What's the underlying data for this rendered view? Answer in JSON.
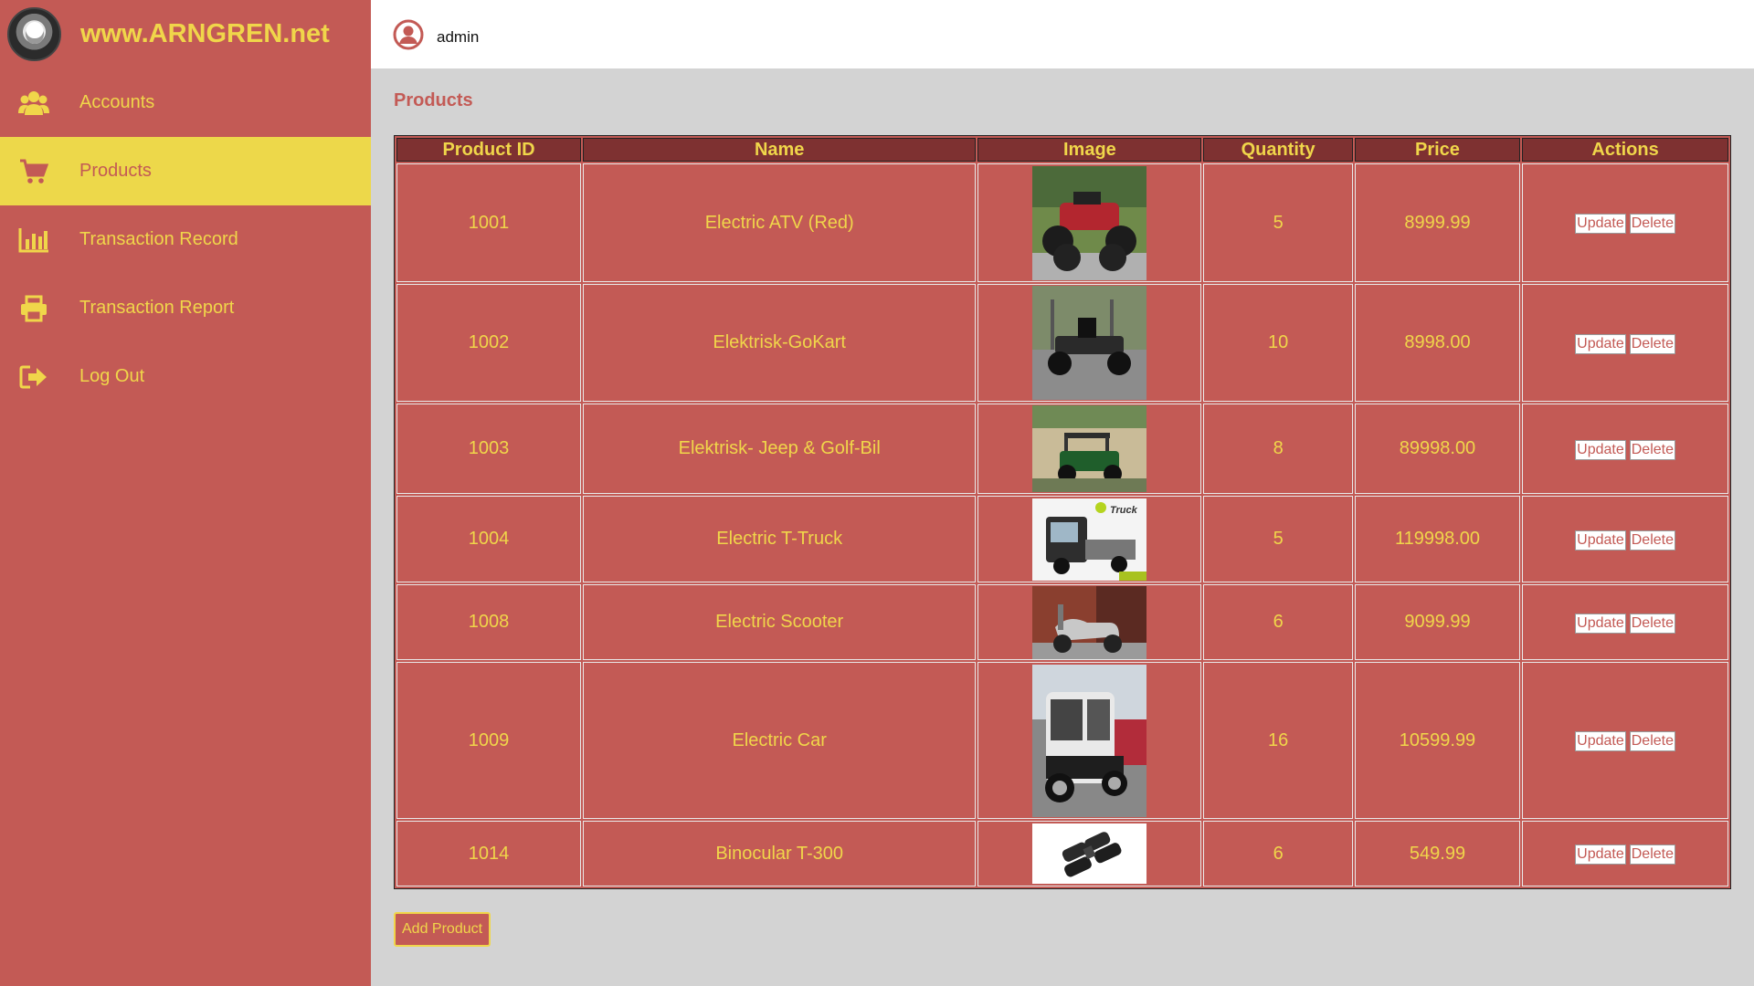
{
  "brand": {
    "title": "www.ARNGREN.net",
    "logo_icon": "arngren-logo"
  },
  "sidebar": {
    "items": [
      {
        "label": "Accounts",
        "icon": "users-icon",
        "active": false
      },
      {
        "label": "Products",
        "icon": "cart-icon",
        "active": true
      },
      {
        "label": "Transaction Record",
        "icon": "bar-chart-icon",
        "active": false
      },
      {
        "label": "Transaction Report",
        "icon": "printer-icon",
        "active": false
      },
      {
        "label": "Log Out",
        "icon": "logout-icon",
        "active": false
      }
    ]
  },
  "topbar": {
    "user": "admin",
    "user_icon": "user-circle-icon"
  },
  "main": {
    "title": "Products",
    "table": {
      "headers": [
        "Product ID",
        "Name",
        "Image",
        "Quantity",
        "Price",
        "Actions"
      ],
      "rows": [
        {
          "id": "1001",
          "name": "Electric ATV (Red)",
          "quantity": "5",
          "price": "8999.99"
        },
        {
          "id": "1002",
          "name": "Elektrisk-GoKart",
          "quantity": "10",
          "price": "8998.00"
        },
        {
          "id": "1003",
          "name": "Elektrisk- Jeep & Golf-Bil",
          "quantity": "8",
          "price": "89998.00"
        },
        {
          "id": "1004",
          "name": "Electric T-Truck",
          "quantity": "5",
          "price": "119998.00"
        },
        {
          "id": "1008",
          "name": "Electric Scooter",
          "quantity": "6",
          "price": "9099.99"
        },
        {
          "id": "1009",
          "name": "Electric Car",
          "quantity": "16",
          "price": "10599.99"
        },
        {
          "id": "1014",
          "name": "Binocular T-300",
          "quantity": "6",
          "price": "549.99"
        }
      ],
      "update_label": "Update",
      "delete_label": "Delete"
    },
    "add_button": "Add Product"
  },
  "colors": {
    "sidebar": "#c35a55",
    "accent": "#f0d64a",
    "active": "#edd84a",
    "header": "#7e3131",
    "background": "#d3d3d3"
  }
}
